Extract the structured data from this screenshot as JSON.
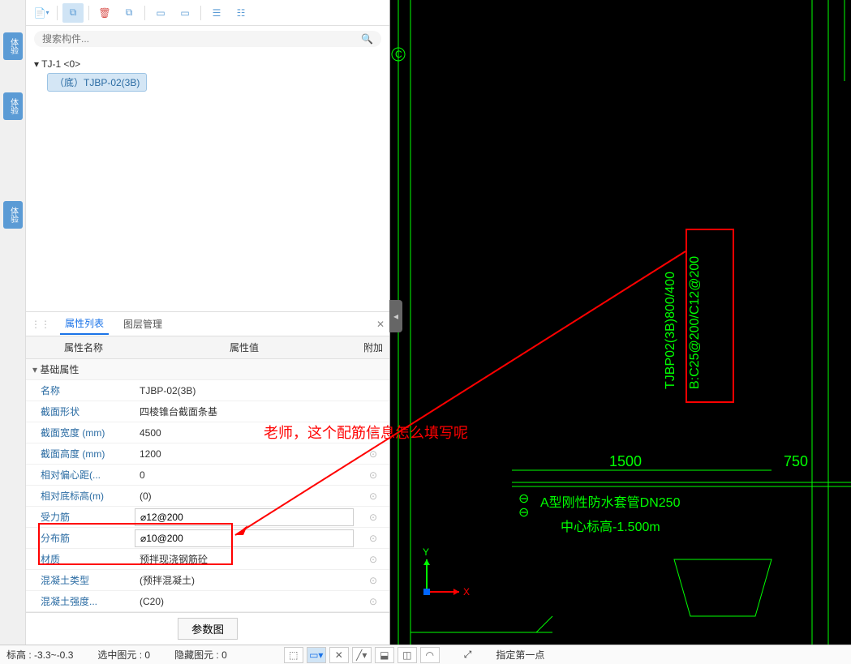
{
  "sidebar_badges": [
    "体验",
    "体验",
    "体验"
  ],
  "search": {
    "placeholder": "搜索构件..."
  },
  "tree": {
    "root": "TJ-1 <0>",
    "child": "（底）TJBP-02(3B)"
  },
  "tabs": {
    "prop": "属性列表",
    "layer": "图层管理"
  },
  "header": {
    "name": "属性名称",
    "val": "属性值",
    "ext": "附加"
  },
  "section_basic": "基础属性",
  "props": {
    "name": {
      "label": "名称",
      "value": "TJBP-02(3B)"
    },
    "shape": {
      "label": "截面形状",
      "value": "四棱锥台截面条基"
    },
    "width": {
      "label": "截面宽度 (mm)",
      "value": "4500"
    },
    "height": {
      "label": "截面高度 (mm)",
      "value": "1200"
    },
    "offset": {
      "label": "相对偏心距(...",
      "value": "0"
    },
    "baseelev": {
      "label": "相对底标高(m)",
      "value": "(0)"
    },
    "mainbar": {
      "label": "受力筋",
      "value": "⌀12@200"
    },
    "distbar": {
      "label": "分布筋",
      "value": "⌀10@200"
    },
    "material": {
      "label": "材质",
      "value": "预拌现浇钢筋砼"
    },
    "conctype": {
      "label": "混凝土类型",
      "value": "(预拌混凝土)"
    },
    "concgrade": {
      "label": "混凝土强度...",
      "value": "(C20)"
    }
  },
  "param_btn": "参数图",
  "annotation": "老师，这个配筋信息怎么填写呢",
  "cad": {
    "label1": "TJBP02(3B)800/400",
    "label2": "B:C25@200/C12@200",
    "dim1": "1500",
    "dim2": "750",
    "pipe": "A型刚性防水套管DN250",
    "elev": "中心标高-1.500m",
    "axis_x": "X",
    "axis_y": "Y",
    "grid_c": "C"
  },
  "status": {
    "elev": "标高 : -3.3~-0.3",
    "selected": "选中图元 : 0",
    "hidden": "隐藏图元 : 0",
    "prompt": "指定第一点"
  }
}
